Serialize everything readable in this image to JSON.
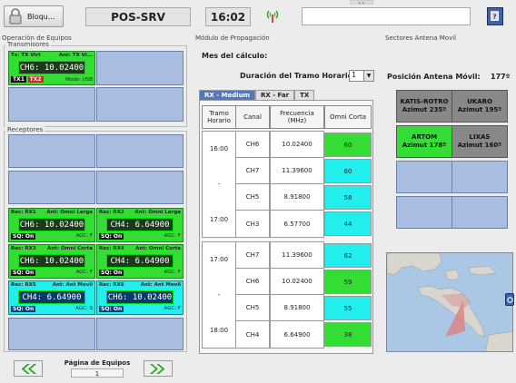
{
  "topbar": {
    "lock_label": "Bloqu...",
    "server": "POS-SRV",
    "clock": "16:02",
    "message": ""
  },
  "equipos": {
    "section_title": "Operación de Equipos",
    "transmisores_label": "Transmisores",
    "receptores_label": "Receptores",
    "tx": {
      "name": "Tx: TX Virt",
      "ant": "Ant: TX Vi...",
      "channel": "CH6: 10.02400",
      "tag1": "TX1",
      "tag2": "TX2",
      "mode": "Modo: USB"
    },
    "rx": [
      {
        "name": "Rec: RX1",
        "ant": "Ant: Omni Larga",
        "channel": "CH6: 10.02400",
        "sq": "SQ: On",
        "agc": "AGC: F",
        "color": "green"
      },
      {
        "name": "Rec: RX2",
        "ant": "Ant: Omni Larga",
        "channel": "CH4:  6.64900",
        "sq": "SQ: On",
        "agc": "AGC: F",
        "color": "green"
      },
      {
        "name": "Rec: RX3",
        "ant": "Ant: Omni Corta",
        "channel": "CH6: 10.02400",
        "sq": "SQ: On",
        "agc": "AGC: F",
        "color": "green"
      },
      {
        "name": "Rec: RX4",
        "ant": "Ant: Omni Corta",
        "channel": "CH4:  6.64900",
        "sq": "SQ: On",
        "agc": "AGC: F",
        "color": "green"
      },
      {
        "name": "Rec: RX5",
        "ant": "Ant: Ant Movil",
        "channel": "CH4:  6.64900",
        "sq": "SQ: On",
        "agc": "AGC: S",
        "color": "cyan"
      },
      {
        "name": "Rec: RX6",
        "ant": "Ant: Ant Movil",
        "channel": "CH6: 10.02400",
        "sq": "SQ: On",
        "agc": "AGC: F",
        "color": "cyan"
      }
    ],
    "page_label": "Página de Equipos",
    "page_number": "1"
  },
  "propagacion": {
    "section_title": "Módulo de Propagación",
    "mes_label": "Mes del cálculo:",
    "duracion_label": "Duración del Tramo Horario",
    "duracion_value": "1",
    "tabs": [
      "RX - Medium",
      "RX - Far",
      "TX"
    ],
    "headers": [
      "Tramo Horario",
      "Canal",
      "Frecuencia (MHz)",
      "Omni Corta"
    ],
    "blocks": [
      {
        "start": "16:00",
        "dash": "-",
        "end": "17:00",
        "rows": [
          {
            "canal": "CH6",
            "freq": "10.02400",
            "omni": "60",
            "color": "green"
          },
          {
            "canal": "CH7",
            "freq": "11.39600",
            "omni": "60",
            "color": "cyan"
          },
          {
            "canal": "CH5",
            "freq": "8.91800",
            "omni": "58",
            "color": "cyan"
          },
          {
            "canal": "CH3",
            "freq": "6.57700",
            "omni": "44",
            "color": "cyan"
          }
        ]
      },
      {
        "start": "17:00",
        "dash": "-",
        "end": "18:00",
        "rows": [
          {
            "canal": "CH7",
            "freq": "11.39600",
            "omni": "62",
            "color": "cyan"
          },
          {
            "canal": "CH6",
            "freq": "10.02400",
            "omni": "59",
            "color": "green"
          },
          {
            "canal": "CH5",
            "freq": "8.91800",
            "omni": "55",
            "color": "cyan"
          },
          {
            "canal": "CH4",
            "freq": "6.64900",
            "omni": "38",
            "color": "green"
          }
        ]
      }
    ]
  },
  "sectores": {
    "section_title": "Sectores Antena Movil",
    "posicion_label": "Posición Antena Móvil:",
    "posicion_value": "177º",
    "buttons": [
      {
        "name": "KATIS-ROTRO",
        "azimut": "Azimut 235º",
        "state": "gray"
      },
      {
        "name": "UKARO",
        "azimut": "Azimut 195º",
        "state": "gray"
      },
      {
        "name": "ARTOM",
        "azimut": "Azimut 178º",
        "state": "active"
      },
      {
        "name": "LIXAS",
        "azimut": "Azimut 160º",
        "state": "gray"
      }
    ]
  }
}
